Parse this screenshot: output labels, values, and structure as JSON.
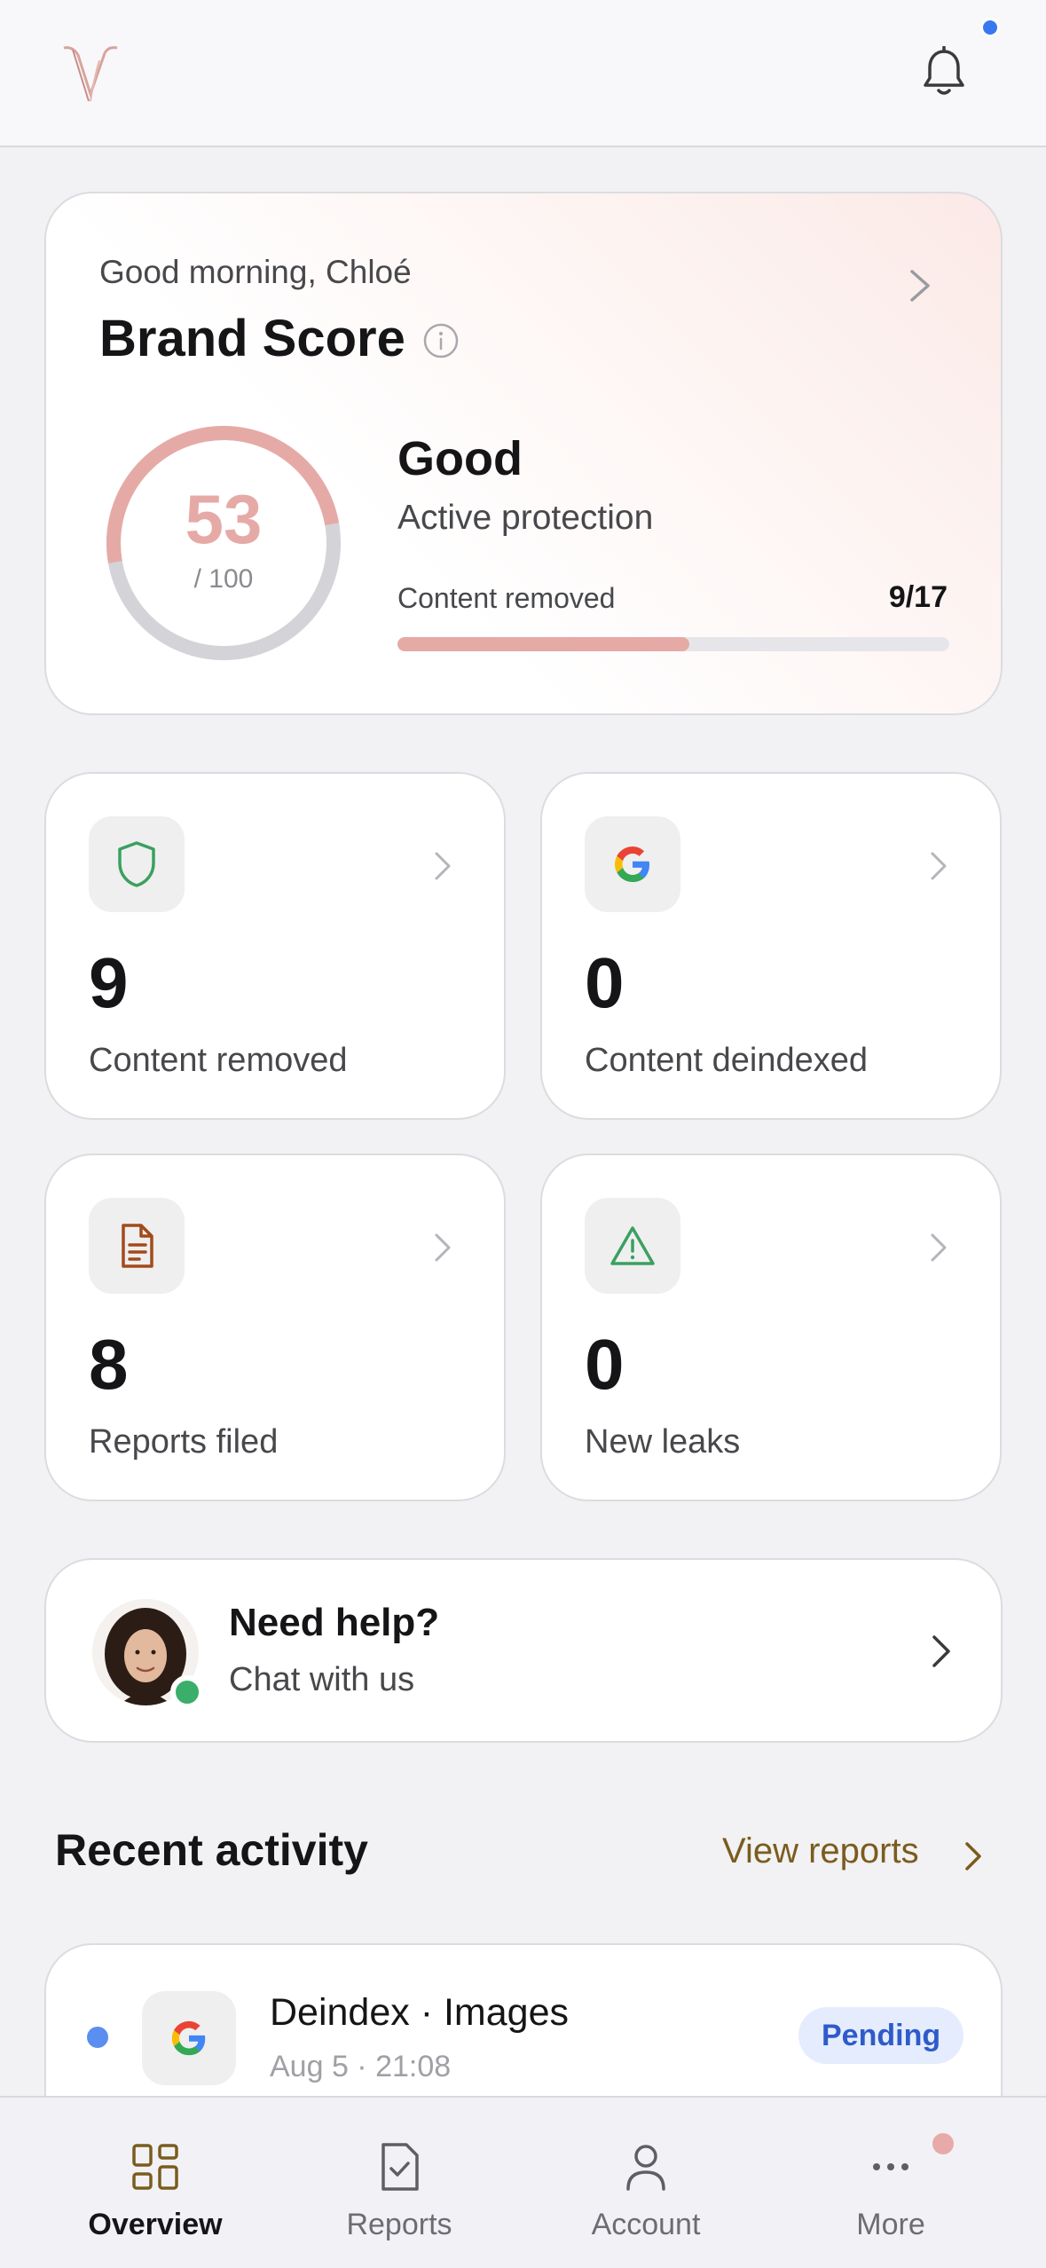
{
  "header": {
    "logo_icon": "v-monogram-logo-icon",
    "notification_icon": "bell-icon",
    "has_unread_notifications": true
  },
  "score_card": {
    "greeting": "Good morning, Chloé",
    "title": "Brand Score",
    "score": "53",
    "score_total": "/ 100",
    "score_fraction": 0.53,
    "status": "Good",
    "status_detail": "Active protection",
    "progress_label": "Content removed",
    "progress_count": "9/17",
    "progress_fraction": 0.529
  },
  "stats": [
    {
      "value": "9",
      "label": "Content removed",
      "icon": "shield-icon"
    },
    {
      "value": "0",
      "label": "Content deindexed",
      "icon": "google-icon"
    },
    {
      "value": "8",
      "label": "Reports filed",
      "icon": "document-icon"
    },
    {
      "value": "0",
      "label": "New leaks",
      "icon": "warning-icon"
    }
  ],
  "help": {
    "title": "Need help?",
    "subtitle": "Chat with us",
    "agent_online": true
  },
  "recent_activity": {
    "title": "Recent activity",
    "view_all": "View reports",
    "items": [
      {
        "title": "Deindex · Images",
        "time": "Aug 5 · 21:08",
        "status": "Pending",
        "icon": "google-icon",
        "unread": true
      }
    ]
  },
  "tabbar": {
    "tabs": [
      {
        "label": "Overview",
        "icon": "grid-icon",
        "active": true
      },
      {
        "label": "Reports",
        "icon": "report-icon",
        "active": false
      },
      {
        "label": "Account",
        "icon": "person-icon",
        "active": false
      },
      {
        "label": "More",
        "icon": "ellipsis-icon",
        "active": false
      }
    ]
  },
  "colors": {
    "accent": "#e6aaa6",
    "link": "#7a5c1e",
    "badge_blue": "#2f5bc9",
    "online": "#3aae6a"
  }
}
